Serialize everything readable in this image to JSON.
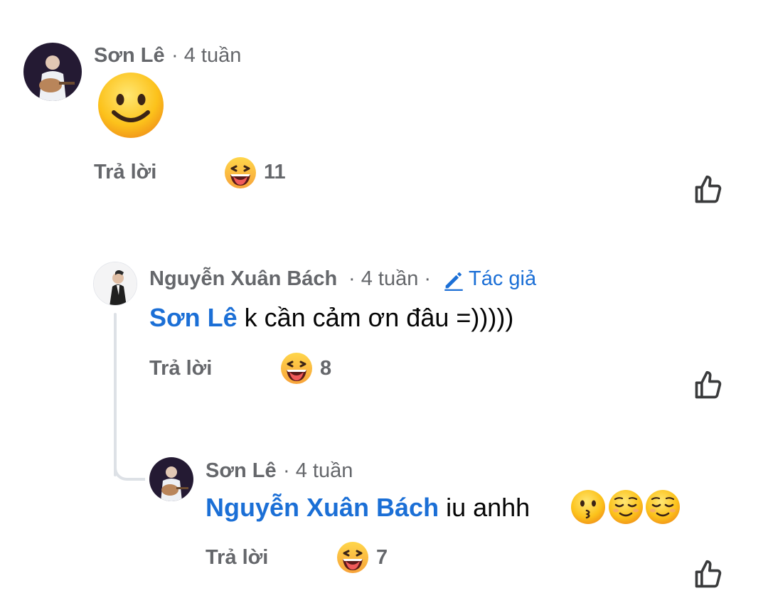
{
  "comments": [
    {
      "author": "Sơn Lê",
      "meta": "· 4 tuần",
      "reply_label": "Trả lời",
      "reaction_count": "11"
    },
    {
      "author": "Nguyễn Xuân Bách",
      "meta": "· 4 tuần ·",
      "badge_label": "Tác giả",
      "mention": "Sơn Lê",
      "text": " k cần cảm ơn đâu =)))))",
      "reply_label": "Trả lời",
      "reaction_count": "8"
    },
    {
      "author": "Sơn Lê",
      "meta": "· 4 tuần",
      "mention": "Nguyễn Xuân Bách",
      "text": " iu anhh",
      "reply_label": "Trả lời",
      "reaction_count": "7"
    }
  ],
  "icons": {
    "reaction": "haha-reaction-icon",
    "like": "thumbs-up-icon",
    "author_badge": "pencil-icon",
    "emoji_smile": "smiling-face-emoji",
    "emoji_kiss": "kissing-face-emoji",
    "emoji_relieved": "relieved-face-emoji"
  },
  "colors": {
    "mention": "#1b6fd6",
    "secondary_text": "#65676b",
    "thread_line": "#dde1e6"
  }
}
